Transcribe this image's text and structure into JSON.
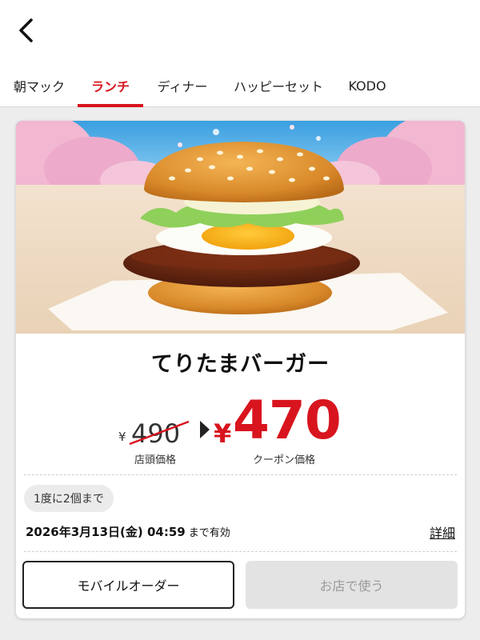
{
  "header": {
    "back_icon": "chevron-left-icon"
  },
  "tabs": [
    {
      "label": "朝マック",
      "active": false
    },
    {
      "label": "ランチ",
      "active": true
    },
    {
      "label": "ディナー",
      "active": false
    },
    {
      "label": "ハッピーセット",
      "active": false
    },
    {
      "label": "KODO",
      "active": false
    }
  ],
  "coupon": {
    "product_name": "てりたまバーガー",
    "original_price": {
      "yen": "¥",
      "amount": "490",
      "label": "店頭価格"
    },
    "coupon_price": {
      "yen": "¥",
      "amount": "470",
      "label": "クーポン価格"
    },
    "limit": "1度に2個まで",
    "valid_until": "2026年3月13日(金) 04:59",
    "valid_suffix": "まで有効",
    "details_link": "詳細",
    "buttons": {
      "mobile_order": "モバイルオーダー",
      "use_in_store": "お店で使う"
    }
  },
  "colors": {
    "accent": "#d8141e",
    "disabled_bg": "#e3e3e3",
    "disabled_text": "#9a9a9a"
  }
}
